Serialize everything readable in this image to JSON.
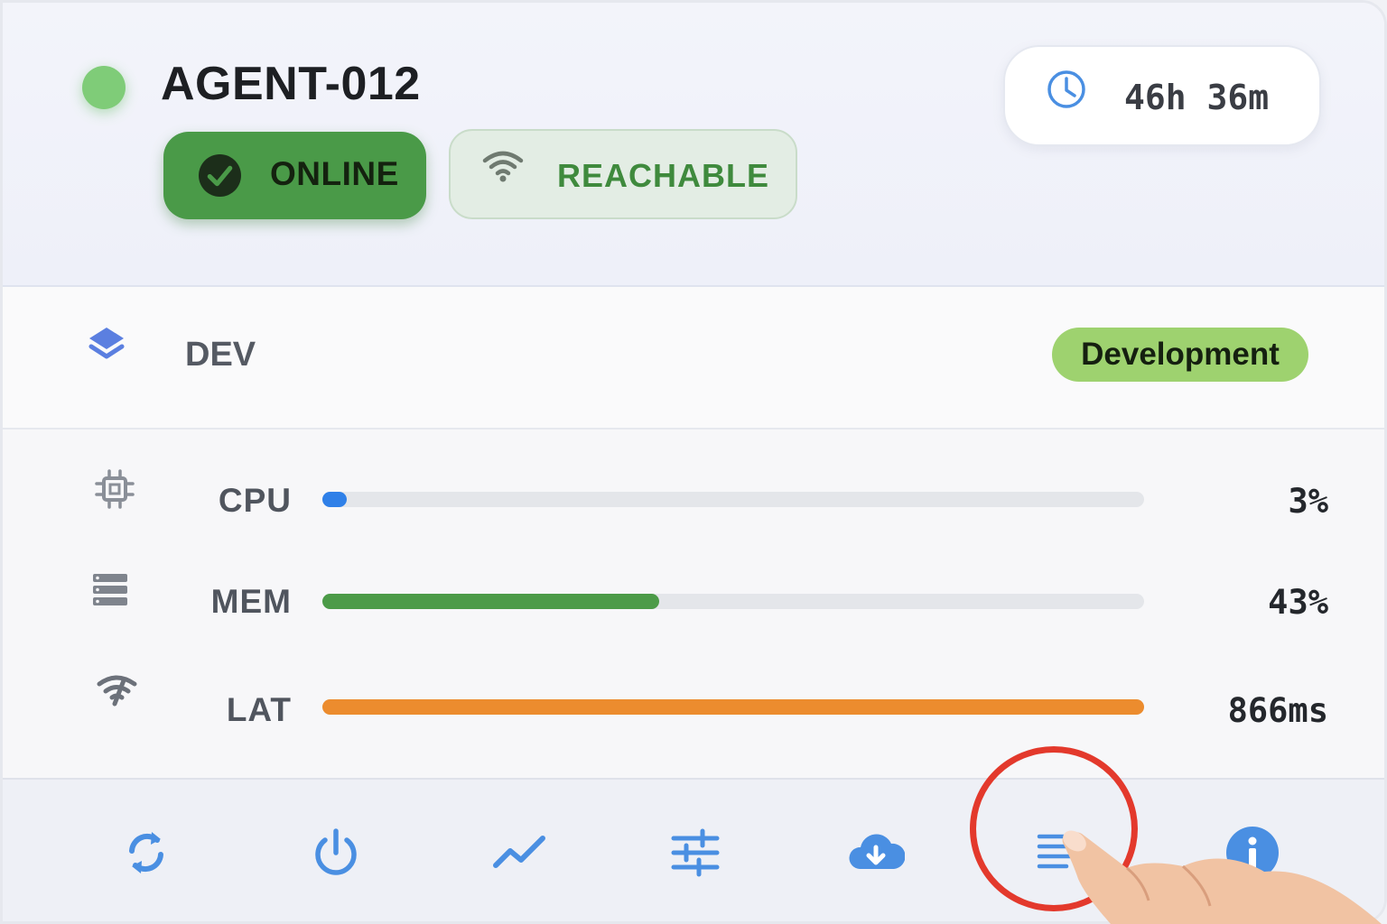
{
  "agent": {
    "name": "AGENT-012",
    "status_label": "ONLINE",
    "reachability_label": "REACHABLE",
    "uptime": "46h 36m"
  },
  "environment": {
    "code": "DEV",
    "badge": "Development"
  },
  "metrics": [
    {
      "key": "cpu",
      "label": "CPU",
      "value_text": "3%",
      "level_percent": 3,
      "color": "#2f80e8",
      "icon": "chip-icon"
    },
    {
      "key": "mem",
      "label": "MEM",
      "value_text": "43%",
      "level_percent": 41,
      "color": "#4c9b48",
      "icon": "memory-icon"
    },
    {
      "key": "lat",
      "label": "LAT",
      "value_text": "866ms",
      "level_percent": 100,
      "color": "#ec8c2e",
      "icon": "signal-icon"
    }
  ],
  "toolbar": {
    "actions": [
      "refresh-icon",
      "power-icon",
      "chart-line-icon",
      "sliders-icon",
      "cloud-download-icon",
      "logs-list-icon",
      "info-icon"
    ],
    "highlighted": "logs-list-icon"
  },
  "colors": {
    "online": "#4a9a48",
    "status_dot": "#7fcc78",
    "accent_icon": "#4a8fe2",
    "env_badge": "#9ed26f",
    "highlight_ring": "#e3392c"
  }
}
